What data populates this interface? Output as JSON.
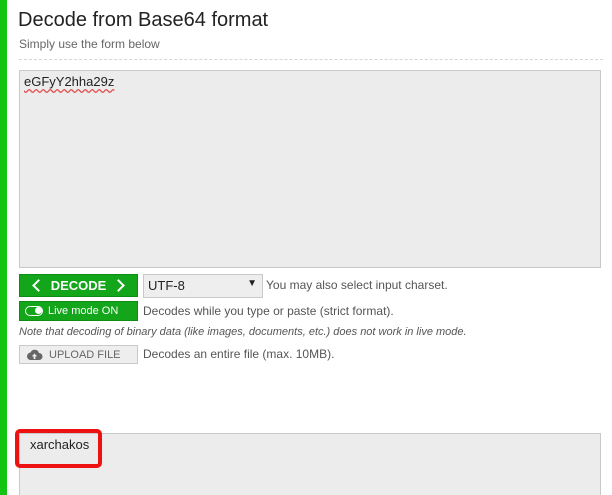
{
  "header": {
    "title": "Decode from Base64 format",
    "subtitle": "Simply use the form below"
  },
  "input": {
    "value": "eGFyY2hha29z"
  },
  "controls": {
    "decode_label": "DECODE",
    "charset_value": "UTF-8",
    "charset_hint": "You may also select input charset.",
    "live_mode_label": "Live mode ON",
    "live_mode_hint": "Decodes while you type or paste (strict format).",
    "live_note": "Note that decoding of binary data (like images, documents, etc.) does not work in live mode.",
    "upload_label": "UPLOAD FILE",
    "upload_hint": "Decodes an entire file (max. 10MB)."
  },
  "output": {
    "value": "xarchakos"
  },
  "colors": {
    "accent_green": "#13a51a",
    "left_bar": "#13c413",
    "highlight_red": "#ee1111"
  },
  "icons": {
    "decode_left": "chevron-left-icon",
    "decode_right": "chevron-right-icon",
    "charset_caret": "caret-down-icon",
    "live_toggle": "toggle-on-icon",
    "upload": "cloud-upload-icon"
  }
}
